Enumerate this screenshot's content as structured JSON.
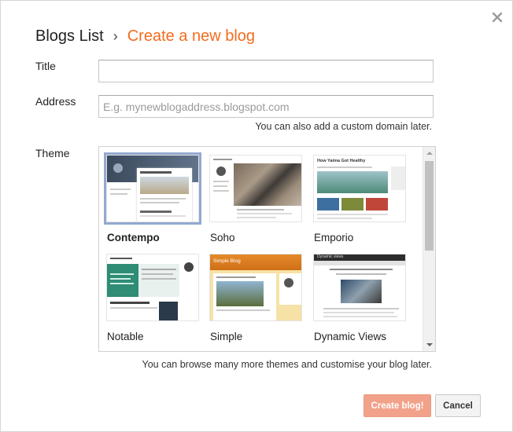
{
  "breadcrumb": {
    "root": "Blogs List",
    "separator": "›",
    "current": "Create a new blog"
  },
  "form": {
    "title_label": "Title",
    "title_value": "",
    "address_label": "Address",
    "address_value": "",
    "address_placeholder": "E.g. mynewblogaddress.blogspot.com",
    "domain_hint": "You can also add a custom domain later.",
    "theme_label": "Theme",
    "themes_hint": "You can browse many more themes and customise your blog later."
  },
  "themes": [
    {
      "name": "Contempo",
      "selected": true
    },
    {
      "name": "Soho",
      "selected": false
    },
    {
      "name": "Emporio",
      "selected": false
    },
    {
      "name": "Notable",
      "selected": false
    },
    {
      "name": "Simple",
      "selected": false
    },
    {
      "name": "Dynamic Views",
      "selected": false
    }
  ],
  "thumb_text": {
    "emporio_heading": "How Yaima Got Healthy",
    "simple_heading": "Simple Blog",
    "dynamic_heading": "Dynamic views"
  },
  "buttons": {
    "create": "Create blog!",
    "cancel": "Cancel"
  },
  "icons": {
    "close": "close-icon",
    "scroll_up": "arrow-up-icon",
    "scroll_down": "arrow-down-icon"
  },
  "colors": {
    "accent": "#f26c1f",
    "create_button": "#f2a28a",
    "selected_border": "#93a9cf"
  }
}
